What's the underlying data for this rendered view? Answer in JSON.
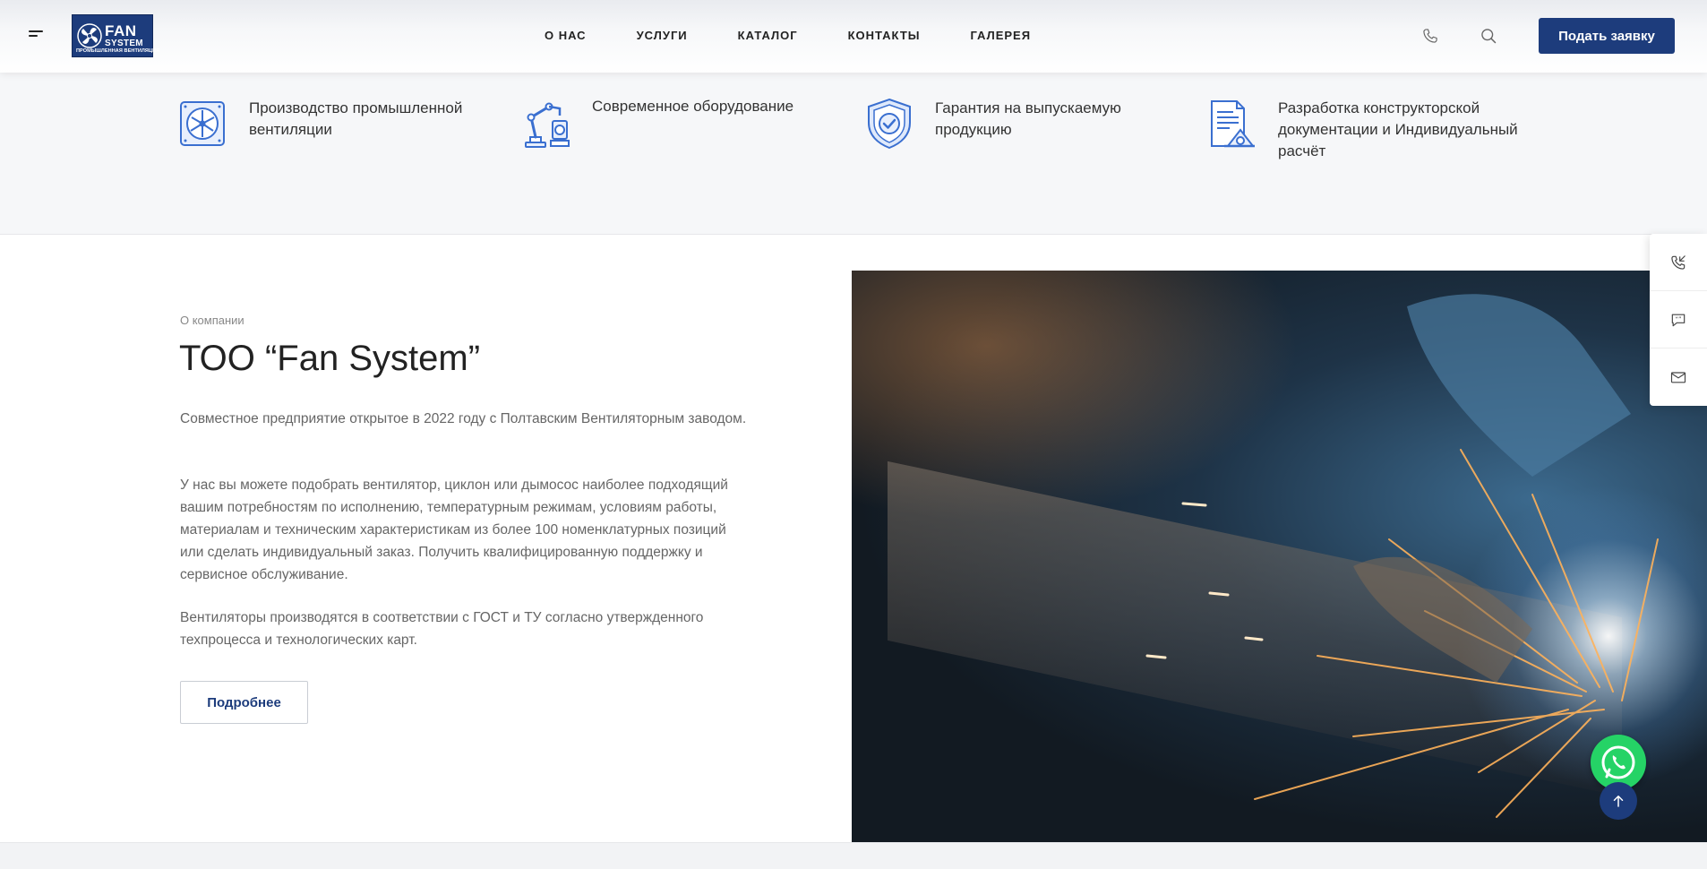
{
  "header": {
    "logo": {
      "line1": "FAN",
      "line2": "SYSTEM",
      "subline": "ПРОМЫШЛЕННАЯ ВЕНТИЛЯЦИЯ"
    },
    "nav": [
      "О НАС",
      "УСЛУГИ",
      "КАТАЛОГ",
      "КОНТАКТЫ",
      "ГАЛЕРЕЯ"
    ],
    "cta_label": "Подать заявку",
    "icons": [
      "menu-icon",
      "phone-icon",
      "search-icon"
    ]
  },
  "features": [
    {
      "icon": "fan-icon",
      "text": "Производство промышленной вентиляции"
    },
    {
      "icon": "robot-arm-icon",
      "text": "Современное оборудование"
    },
    {
      "icon": "shield-check-icon",
      "text": "Гарантия на выпускаемую продукцию"
    },
    {
      "icon": "document-drawing-icon",
      "text": "Разработка конструкторской документации и Индивидуальный расчёт"
    }
  ],
  "about": {
    "label": "О компании",
    "title": "ТОО “Fan System”",
    "paragraphs": [
      "Совместное предприятие открытое в 2022 году с Полтавским Вентиляторным заводом.",
      "У нас вы можете подобрать вентилятор, циклон или дымосос наиболее подходящий вашим потребностям по исполнению, температурным режимам, условиям работы, материалам и техническим характеристикам из более 100 номенклатурных позиций или сделать индивидуальный заказ. Получить квалифицированную поддержку и сервисное обслуживание.",
      "Вентиляторы производятся в соответствии с ГОСТ и ТУ согласно утвержденного техпроцесса и технологических карт."
    ],
    "more_label": "Подробнее"
  },
  "side_widget": [
    "callback-phone-icon",
    "chat-icon",
    "mail-icon"
  ],
  "floating": [
    "whatsapp-icon",
    "arrow-up-icon"
  ],
  "colors": {
    "brand": "#1d3c7c",
    "whatsapp": "#25d366",
    "icon_blue": "#3a6fd0"
  }
}
